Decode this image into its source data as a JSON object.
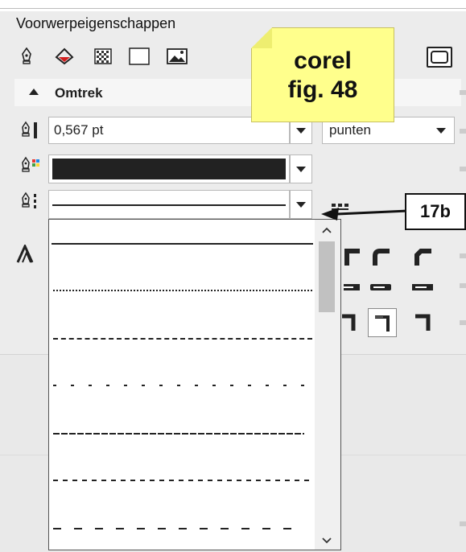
{
  "panel": {
    "title": "Voorwerpeigenschappen",
    "section": "Omtrek"
  },
  "toolbar": {
    "icons": [
      "pen-icon",
      "fill-bucket-icon",
      "checker-pattern-icon",
      "rectangle-icon",
      "image-icon"
    ]
  },
  "outline": {
    "width_value": "0,567 pt",
    "units_value": "punten",
    "color": "#222222"
  },
  "annotation": {
    "sticky_line1": "corel",
    "sticky_line2": "fig. 48",
    "callout": "17b"
  },
  "line_styles": [
    "solid",
    "solid",
    "dotted-fine",
    "dashed-short",
    "dashed-spaced",
    "dashed-long",
    "dashed-medium",
    "dashed-wide"
  ]
}
